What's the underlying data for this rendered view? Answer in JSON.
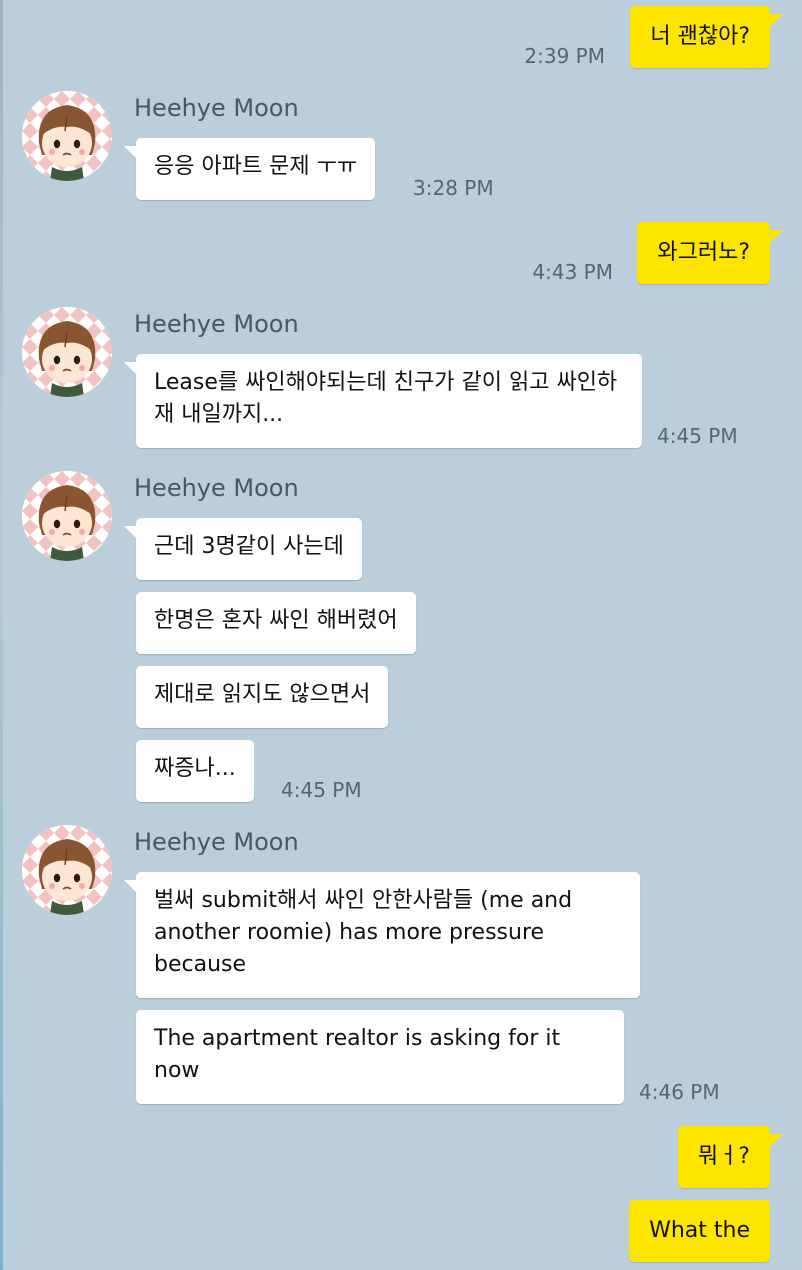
{
  "colors": {
    "background": "#bacfdb",
    "incoming_bubble": "#ffffff",
    "outgoing_bubble": "#fee500",
    "timestamp": "#556672",
    "sender_name": "#4a5761"
  },
  "contact": {
    "name": "Heehye Moon",
    "avatar_icon": "cartoon-girl-avatar-icon"
  },
  "messages": [
    {
      "dir": "out",
      "text": "너 괜찮아?",
      "time": "2:39 PM"
    },
    {
      "dir": "in",
      "sender": "Heehye Moon",
      "text": "응응 아파트 문제 ㅜㅠ",
      "time": "3:28 PM"
    },
    {
      "dir": "out",
      "text": "와그러노?",
      "time": "4:43 PM"
    },
    {
      "dir": "in",
      "sender": "Heehye Moon",
      "text": "Lease를 싸인해야되는데 친구가 같이 읽고 싸인하재 내일까지...",
      "time": "4:45 PM"
    },
    {
      "dir": "in",
      "sender": "Heehye Moon",
      "text": "근데 3명같이 사는데"
    },
    {
      "dir": "in",
      "text": "한명은 혼자 싸인 해버렸어"
    },
    {
      "dir": "in",
      "text": "제대로 읽지도 않으면서"
    },
    {
      "dir": "in",
      "text": "짜증나...",
      "time": "4:45 PM"
    },
    {
      "dir": "in",
      "sender": "Heehye Moon",
      "text": "벌써 submit해서 싸인 안한사람들 (me and another roomie) has more pressure because"
    },
    {
      "dir": "in",
      "text": "The apartment realtor is asking for it now",
      "time": "4:46 PM"
    },
    {
      "dir": "out",
      "text": "뭐ㅓ?"
    },
    {
      "dir": "out",
      "text": "What the"
    }
  ]
}
